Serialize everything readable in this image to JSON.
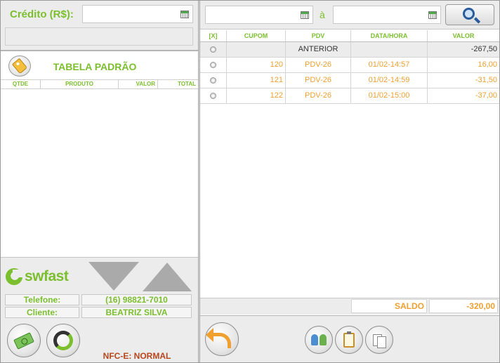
{
  "credit": {
    "label": "Crédito (R$):",
    "value": ""
  },
  "price_table": {
    "title": "TABELA PADRÃO"
  },
  "items": {
    "columns": [
      "QTDE",
      "PRODUTO",
      "VALOR",
      "TOTAL"
    ]
  },
  "customer": {
    "phone_label": "Telefone:",
    "phone": "(16) 98821-7010",
    "client_label": "Cliente:",
    "client": "BEATRIZ SILVA"
  },
  "nfce_status": "NFC-E: NORMAL",
  "brand": {
    "logo_text": "swfast",
    "primary_color": "#7bbf2e",
    "accent_color": "#f0a030"
  },
  "filter": {
    "date_from": "",
    "separator": "à",
    "date_to": ""
  },
  "grid": {
    "columns": [
      "[X]",
      "CUPOM",
      "PDV",
      "DATA/HORA",
      "VALOR"
    ],
    "rows": [
      {
        "cupom": "",
        "pdv": "ANTERIOR",
        "datetime": "",
        "valor": "-267,50"
      },
      {
        "cupom": "120",
        "pdv": "PDV-26",
        "datetime": "01/02-14:57",
        "valor": "16,00"
      },
      {
        "cupom": "121",
        "pdv": "PDV-26",
        "datetime": "01/02-14:59",
        "valor": "-31,50"
      },
      {
        "cupom": "122",
        "pdv": "PDV-26",
        "datetime": "01/02-15:00",
        "valor": "-37,00"
      }
    ]
  },
  "saldo": {
    "label": "SALDO",
    "value": "-320,00"
  },
  "icons": {
    "tag": "price-tag-icon",
    "search": "magnifier-icon",
    "money": "cash-icon",
    "sync": "sync-icon",
    "back": "back-arrow-icon",
    "users": "users-icon",
    "clipboard": "clipboard-icon",
    "copy": "copy-icon"
  }
}
